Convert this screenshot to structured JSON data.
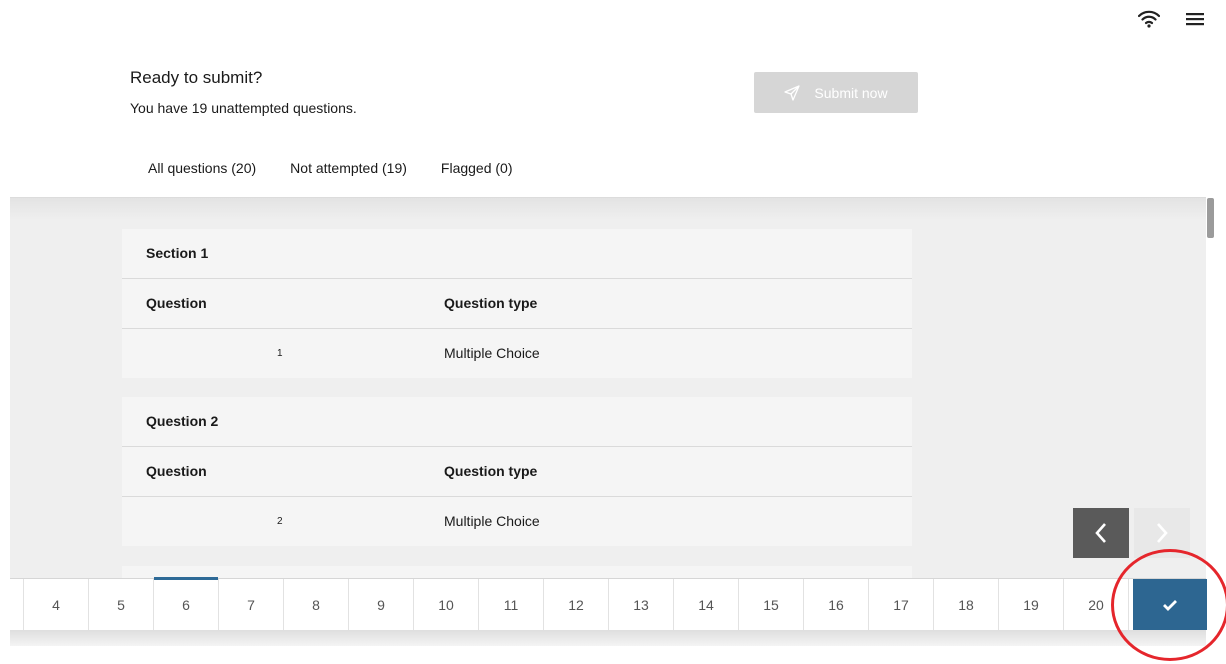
{
  "header": {
    "title": "Ready to submit?",
    "subtitle": "You have 19 unattempted questions.",
    "submit_label": "Submit now"
  },
  "tabs": [
    {
      "label": "All questions (20)"
    },
    {
      "label": "Not attempted (19)"
    },
    {
      "label": "Flagged (0)"
    }
  ],
  "sections": [
    {
      "title": "Section 1",
      "col_question": "Question",
      "col_type": "Question type",
      "row": {
        "number": "1",
        "type": "Multiple Choice"
      }
    },
    {
      "title": "Question 2",
      "col_question": "Question",
      "col_type": "Question type",
      "row": {
        "number": "2",
        "type": "Multiple Choice"
      }
    }
  ],
  "bottom_nav": {
    "pages": [
      "4",
      "5",
      "6",
      "7",
      "8",
      "9",
      "10",
      "11",
      "12",
      "13",
      "14",
      "15",
      "16",
      "17",
      "18",
      "19",
      "20"
    ],
    "active_page": "6"
  },
  "icons": {
    "wifi": "wifi-icon",
    "menu": "hamburger-menu-icon",
    "prev": "chevron-left-icon",
    "next": "chevron-right-icon",
    "review": "checkmark-icon",
    "submit": "paper-plane-icon"
  },
  "colors": {
    "accent": "#2d6691",
    "highlight": "#e5262c",
    "submit_disabled": "#d6d6d6"
  }
}
